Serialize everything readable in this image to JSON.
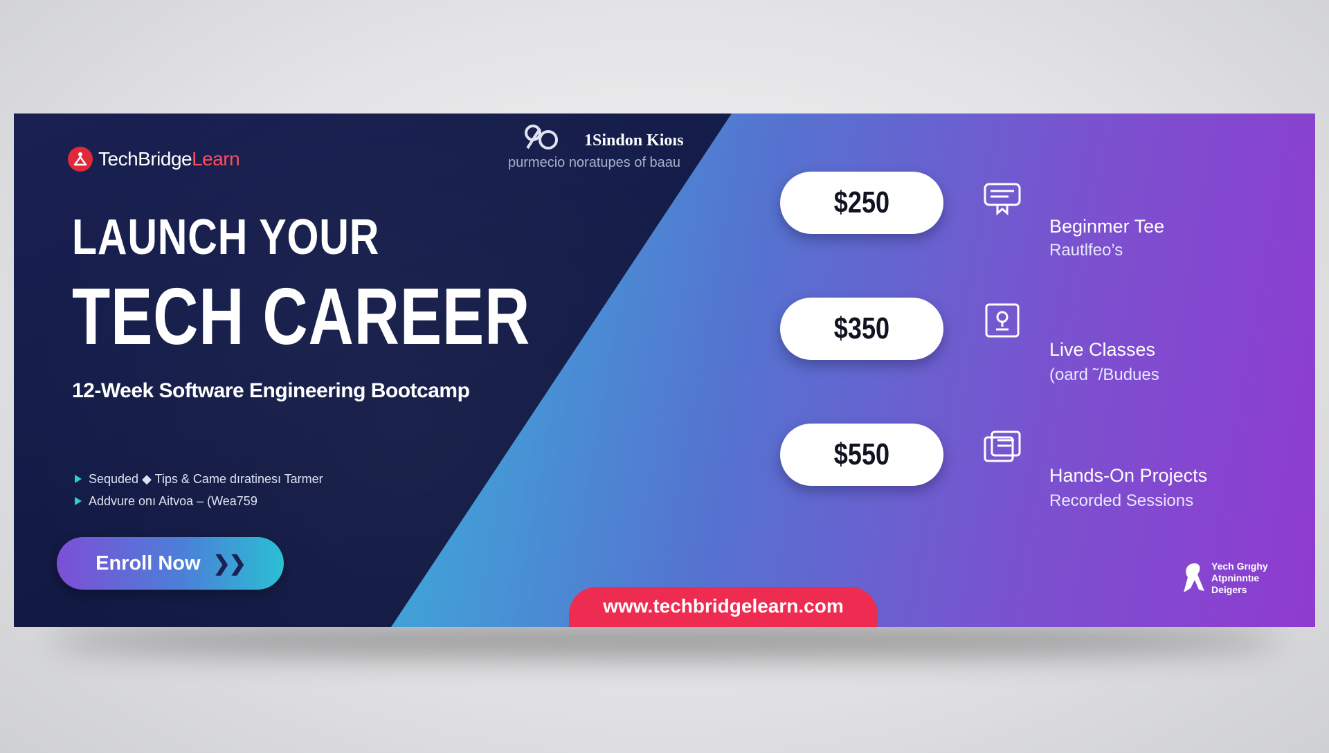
{
  "brand": {
    "name_primary": "TechBridge",
    "name_accent": "Learn"
  },
  "partner": {
    "name": "1Sindon Kioıs",
    "tagline": "purmecio noratupes of baau"
  },
  "hero": {
    "headline_line1": "LAUNCH YOUR",
    "headline_line2": "TECH CAREER",
    "subtitle": "12-Week Software Engineering Bootcamp"
  },
  "bullets": [
    "Sequded ◆ Tips & Came dıratinesı Tarmer",
    "Addvure onı Aitvoa – (Wea759"
  ],
  "cta": {
    "label": "Enroll Now",
    "arrow": "❯❯"
  },
  "pricing": [
    {
      "price": "$250",
      "icon": "certificate-icon",
      "title": "Beginmer Tee",
      "subtitle": "Rautlfeo’s"
    },
    {
      "price": "$350",
      "icon": "live-class-icon",
      "title": "Live Classes",
      "subtitle": "(oard ˜/Budues"
    },
    {
      "price": "$550",
      "icon": "projects-icon",
      "title": "Hands-On Projects",
      "subtitle": "Recorded  Sessions"
    }
  ],
  "website": "www.techbridgelearn.com",
  "corner_brand": {
    "line1": "Yech Grıghy",
    "line2": "Atpninntıe",
    "line3": "Deigers"
  },
  "colors": {
    "navy": "#121a45",
    "accent_red": "#ee2b50",
    "teal": "#2fc3d2",
    "purple": "#8f3bd0"
  }
}
